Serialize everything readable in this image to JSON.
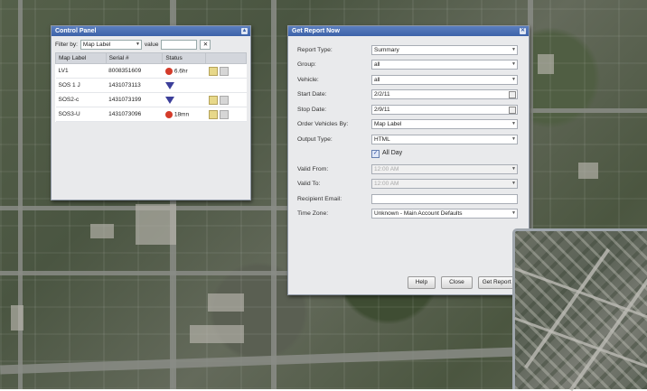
{
  "control_panel": {
    "title": "Control Panel",
    "filter_label": "Filter by:",
    "filter_value": "Map Label",
    "value_label": "value",
    "value_input": "",
    "columns": [
      "Map Label",
      "Serial #",
      "Status"
    ],
    "rows": [
      {
        "label": "LV1",
        "serial": "8008351609",
        "status_icon": "stop-icon",
        "status_text": "6.6hr"
      },
      {
        "label": "SOS 1 J",
        "serial": "1431073113",
        "status_icon": "moving-triangle-icon",
        "status_text": ""
      },
      {
        "label": "SOS2-c",
        "serial": "1431073199",
        "status_icon": "moving-triangle-icon",
        "status_text": ""
      },
      {
        "label": "SOS3-U",
        "serial": "1431073096",
        "status_icon": "stop-icon",
        "status_text": "18mn"
      }
    ]
  },
  "report_dialog": {
    "title": "Get Report Now",
    "fields": {
      "report_type": {
        "label": "Report Type:",
        "value": "Summary"
      },
      "group": {
        "label": "Group:",
        "value": "all"
      },
      "vehicle": {
        "label": "Vehicle:",
        "value": "all"
      },
      "start_date": {
        "label": "Start Date:",
        "value": "2/2/11"
      },
      "stop_date": {
        "label": "Stop Date:",
        "value": "2/9/11"
      },
      "order_by": {
        "label": "Order Vehicles By:",
        "value": "Map Label"
      },
      "output_type": {
        "label": "Output Type:",
        "value": "HTML"
      },
      "all_day": {
        "label": "All Day",
        "checked": true
      },
      "valid_from": {
        "label": "Valid From:",
        "value": "12:00 AM"
      },
      "valid_to": {
        "label": "Valid To:",
        "value": "12:00 AM"
      },
      "recipient_email": {
        "label": "Recipient Email:",
        "value": ""
      },
      "time_zone": {
        "label": "Time Zone:",
        "value": "Unknown - Main Account Defaults"
      }
    },
    "buttons": {
      "help": "Help",
      "close": "Close",
      "get_report": "Get Report N"
    }
  }
}
